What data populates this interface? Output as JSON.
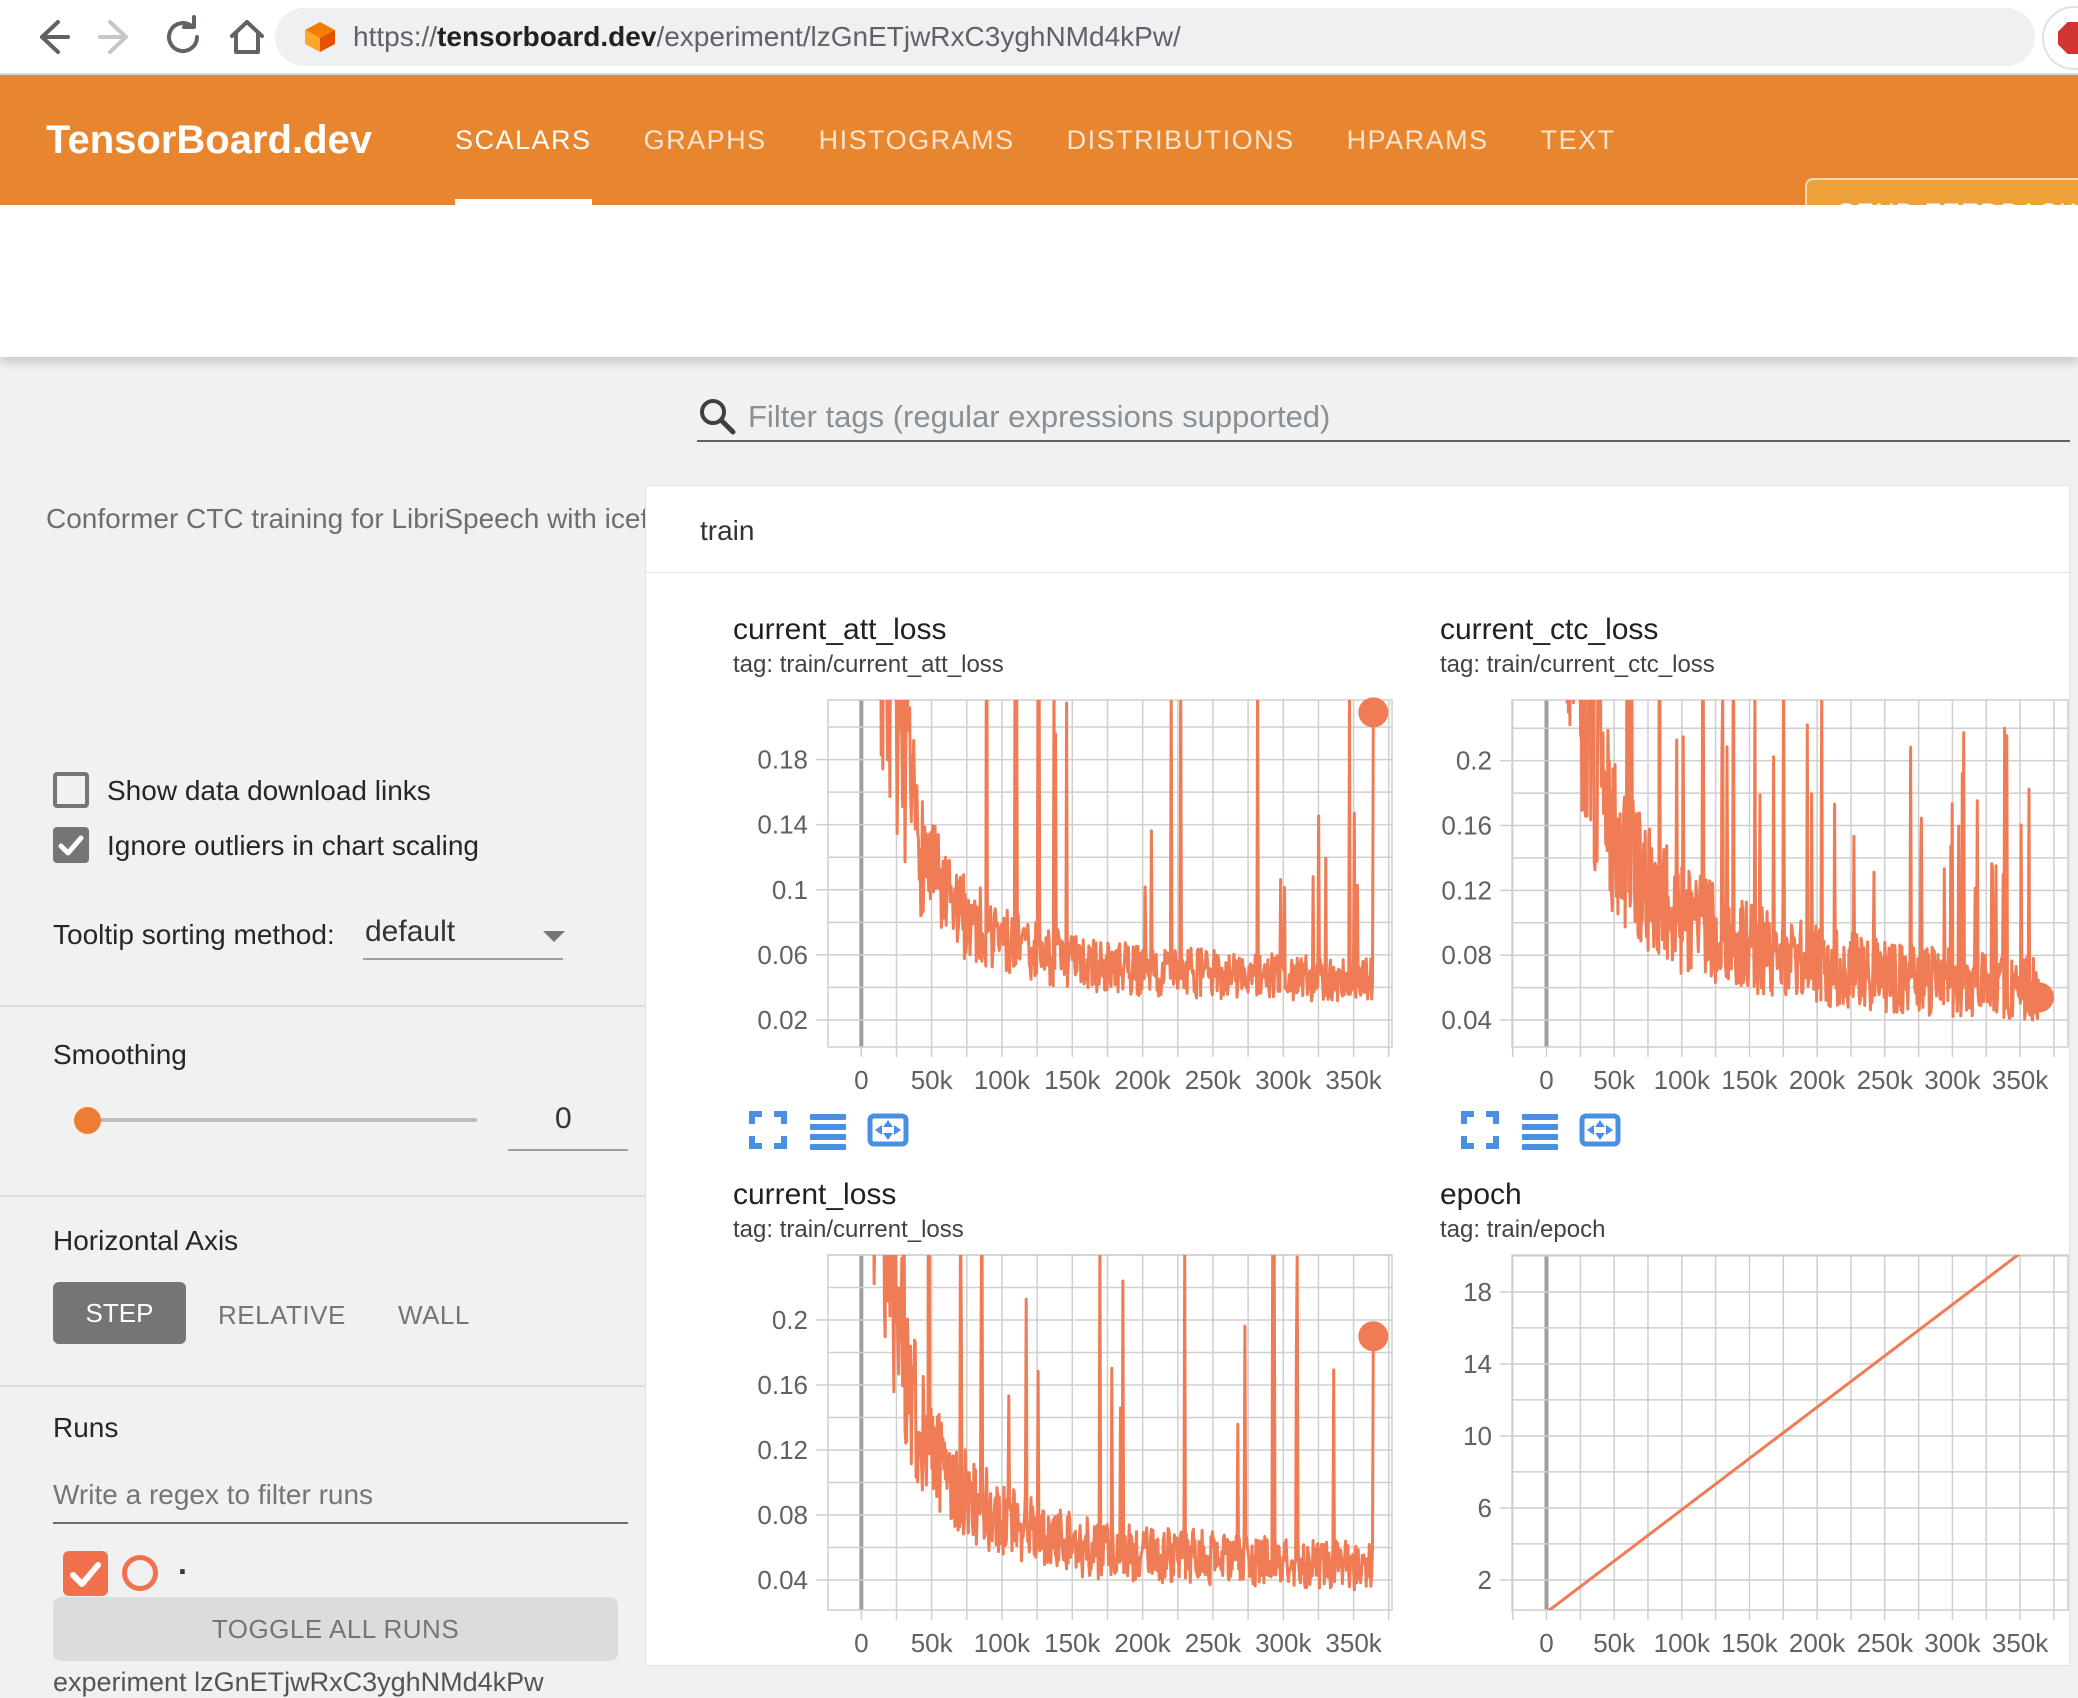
{
  "browser": {
    "url_scheme": "https://",
    "url_domain": "tensorboard.dev",
    "url_path": "/experiment/lzGnETjwRxC3yghNMd4kPw/"
  },
  "header": {
    "brand": "TensorBoard.dev",
    "tabs": [
      {
        "label": "SCALARS",
        "active": true
      },
      {
        "label": "GRAPHS",
        "active": false
      },
      {
        "label": "HISTOGRAMS",
        "active": false
      },
      {
        "label": "DISTRIBUTIONS",
        "active": false
      },
      {
        "label": "HPARAMS",
        "active": false
      },
      {
        "label": "TEXT",
        "active": false
      }
    ],
    "feedback_label": "SEND FEEDBACK"
  },
  "experiment_title": "Conformer CTC training for LibriSpeech with icefall",
  "sidebar": {
    "checkboxes": [
      {
        "label": "Show data download links",
        "checked": false
      },
      {
        "label": "Ignore outliers in chart scaling",
        "checked": true
      }
    ],
    "tooltip_sort": {
      "label": "Tooltip sorting method:",
      "value": "default"
    },
    "smoothing": {
      "label": "Smoothing",
      "value": "0"
    },
    "horizontal_axis": {
      "label": "Horizontal Axis",
      "options": [
        {
          "label": "STEP",
          "selected": true
        },
        {
          "label": "RELATIVE",
          "selected": false
        },
        {
          "label": "WALL",
          "selected": false
        }
      ]
    },
    "runs": {
      "label": "Runs",
      "filter_placeholder": "Write a regex to filter runs",
      "run_name": ".",
      "run_checked": true,
      "toggle_label": "TOGGLE ALL RUNS",
      "experiment_caption": "experiment lzGnETjwRxC3yghNMd4kPw"
    }
  },
  "main": {
    "filter_placeholder": "Filter tags (regular expressions supported)",
    "group_label": "train"
  },
  "colors": {
    "header_orange": "#e8862f",
    "feedback_orange": "#f0a23a",
    "run_orange": "#f0714b",
    "series_orange": "#f07c55",
    "icon_blue": "#4a90e2",
    "grid_gray": "#cfcfcf",
    "zero_line_gray": "#9e9e9e",
    "control_gray": "#757575"
  },
  "chart_data": [
    {
      "type": "line",
      "title": "current_att_loss",
      "tag": "tag: train/current_att_loss",
      "x_range": [
        -23700,
        377300
      ],
      "y_range": [
        0.0034,
        0.2166
      ],
      "x_minor_step": 25000,
      "x_ticks": [
        {
          "v": 0,
          "label": "0"
        },
        {
          "v": 50000,
          "label": "50k"
        },
        {
          "v": 100000,
          "label": "100k"
        },
        {
          "v": 150000,
          "label": "150k"
        },
        {
          "v": 200000,
          "label": "200k"
        },
        {
          "v": 250000,
          "label": "250k"
        },
        {
          "v": 300000,
          "label": "300k"
        },
        {
          "v": 350000,
          "label": "350k"
        }
      ],
      "y_grid_step": 0.02,
      "y_ticks": [
        {
          "v": 0.02,
          "label": "0.02"
        },
        {
          "v": 0.06,
          "label": "0.06"
        },
        {
          "v": 0.1,
          "label": "0.1"
        },
        {
          "v": 0.14,
          "label": "0.14"
        },
        {
          "v": 0.18,
          "label": "0.18"
        }
      ],
      "series": {
        "x_start": 4000,
        "x_end": 364000,
        "n": 640,
        "seed": 7,
        "spike_prob": 0.05,
        "spike_mag": 3.4,
        "band_lo": 0.72,
        "band_w": 0.66,
        "early_boost": 1.3,
        "anchors": [
          [
            4000,
            0.3
          ],
          [
            20000,
            0.21
          ],
          [
            40000,
            0.12
          ],
          [
            60000,
            0.088
          ],
          [
            80000,
            0.076
          ],
          [
            100000,
            0.066
          ],
          [
            130000,
            0.058
          ],
          [
            160000,
            0.051
          ],
          [
            200000,
            0.048
          ],
          [
            250000,
            0.046
          ],
          [
            300000,
            0.044
          ],
          [
            364000,
            0.042
          ]
        ],
        "end": 0.209
      },
      "end_dot": true
    },
    {
      "type": "line",
      "title": "current_ctc_loss",
      "tag": "tag: train/current_ctc_loss",
      "x_range": [
        -25500,
        385400
      ],
      "y_range": [
        0.0234,
        0.2374
      ],
      "x_minor_step": 25000,
      "x_ticks": [
        {
          "v": 0,
          "label": "0"
        },
        {
          "v": 50000,
          "label": "50k"
        },
        {
          "v": 100000,
          "label": "100k"
        },
        {
          "v": 150000,
          "label": "150k"
        },
        {
          "v": 200000,
          "label": "200k"
        },
        {
          "v": 250000,
          "label": "250k"
        },
        {
          "v": 300000,
          "label": "300k"
        },
        {
          "v": 350000,
          "label": "350k"
        }
      ],
      "y_grid_step": 0.02,
      "y_ticks": [
        {
          "v": 0.04,
          "label": "0.04"
        },
        {
          "v": 0.08,
          "label": "0.08"
        },
        {
          "v": 0.12,
          "label": "0.12"
        },
        {
          "v": 0.16,
          "label": "0.16"
        },
        {
          "v": 0.2,
          "label": "0.2"
        }
      ],
      "series": {
        "x_start": 4000,
        "x_end": 364000,
        "n": 680,
        "seed": 13,
        "spike_prob": 0.085,
        "spike_mag": 1.9,
        "band_lo": 0.7,
        "band_w": 0.7,
        "early_boost": 1.1,
        "anchors": [
          [
            4000,
            0.42
          ],
          [
            15000,
            0.3
          ],
          [
            30000,
            0.2
          ],
          [
            50000,
            0.145
          ],
          [
            70000,
            0.12
          ],
          [
            100000,
            0.098
          ],
          [
            130000,
            0.088
          ],
          [
            160000,
            0.078
          ],
          [
            200000,
            0.07
          ],
          [
            250000,
            0.064
          ],
          [
            300000,
            0.06
          ],
          [
            364000,
            0.056
          ]
        ],
        "end": 0.054
      },
      "end_dot": true
    },
    {
      "type": "line",
      "title": "current_loss",
      "tag": "tag: train/current_loss",
      "x_range": [
        -23700,
        377300
      ],
      "y_range": [
        0.0215,
        0.24
      ],
      "x_minor_step": 25000,
      "x_ticks": [
        {
          "v": 0,
          "label": "0"
        },
        {
          "v": 50000,
          "label": "50k"
        },
        {
          "v": 100000,
          "label": "100k"
        },
        {
          "v": 150000,
          "label": "150k"
        },
        {
          "v": 200000,
          "label": "200k"
        },
        {
          "v": 250000,
          "label": "250k"
        },
        {
          "v": 300000,
          "label": "300k"
        },
        {
          "v": 350000,
          "label": "350k"
        }
      ],
      "y_grid_step": 0.02,
      "y_ticks": [
        {
          "v": 0.04,
          "label": "0.04"
        },
        {
          "v": 0.08,
          "label": "0.08"
        },
        {
          "v": 0.12,
          "label": "0.12"
        },
        {
          "v": 0.16,
          "label": "0.16"
        },
        {
          "v": 0.2,
          "label": "0.2"
        }
      ],
      "series": {
        "x_start": 4000,
        "x_end": 364000,
        "n": 640,
        "seed": 21,
        "spike_prob": 0.05,
        "spike_mag": 3.4,
        "band_lo": 0.72,
        "band_w": 0.66,
        "early_boost": 1.3,
        "anchors": [
          [
            4000,
            0.32
          ],
          [
            20000,
            0.23
          ],
          [
            40000,
            0.13
          ],
          [
            60000,
            0.096
          ],
          [
            80000,
            0.084
          ],
          [
            100000,
            0.073
          ],
          [
            130000,
            0.064
          ],
          [
            160000,
            0.057
          ],
          [
            200000,
            0.054
          ],
          [
            250000,
            0.051
          ],
          [
            300000,
            0.048
          ],
          [
            364000,
            0.046
          ]
        ],
        "end": 0.19
      },
      "end_dot": true
    },
    {
      "type": "line",
      "title": "epoch",
      "tag": "tag: train/epoch",
      "x_range": [
        -25500,
        385400
      ],
      "y_range": [
        0.33,
        20.05
      ],
      "x_minor_step": 25000,
      "x_ticks": [
        {
          "v": 0,
          "label": "0"
        },
        {
          "v": 50000,
          "label": "50k"
        },
        {
          "v": 100000,
          "label": "100k"
        },
        {
          "v": 150000,
          "label": "150k"
        },
        {
          "v": 200000,
          "label": "200k"
        },
        {
          "v": 250000,
          "label": "250k"
        },
        {
          "v": 300000,
          "label": "300k"
        },
        {
          "v": 350000,
          "label": "350k"
        }
      ],
      "y_grid_step": 2,
      "y_ticks": [
        {
          "v": 2,
          "label": "2"
        },
        {
          "v": 6,
          "label": "6"
        },
        {
          "v": 10,
          "label": "10"
        },
        {
          "v": 14,
          "label": "14"
        },
        {
          "v": 18,
          "label": "18"
        }
      ],
      "straight_points": [
        [
          0,
          0.2
        ],
        [
          365000,
          21.0
        ]
      ],
      "end_dot": false
    }
  ]
}
